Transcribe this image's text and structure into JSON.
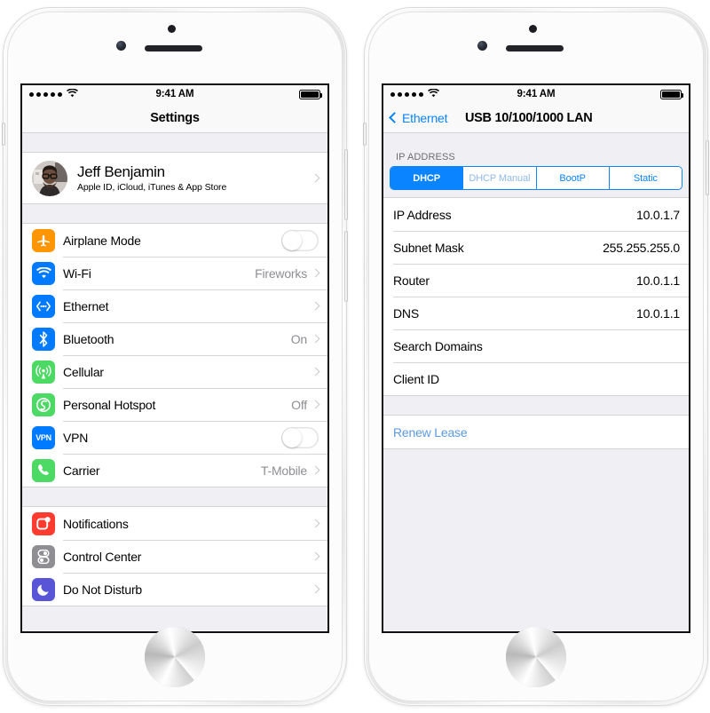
{
  "left_phone": {
    "status_bar": {
      "signal_dots": 5,
      "wifi_icon": "wifi-icon",
      "time": "9:41 AM",
      "battery_icon": "battery-full-icon",
      "battery_level": 100
    },
    "navbar": {
      "title": "Settings"
    },
    "account": {
      "avatar": "user-avatar",
      "name": "Jeff Benjamin",
      "subtitle": "Apple ID, iCloud, iTunes & App Store",
      "chevron": "chevron-right-icon"
    },
    "group_one": [
      {
        "icon": "airplane-icon",
        "icon_color": "#FF9500",
        "label": "Airplane Mode",
        "control": "toggle",
        "toggle_on": false
      },
      {
        "icon": "wifi-icon",
        "icon_color": "#007AFF",
        "label": "Wi-Fi",
        "value": "Fireworks",
        "control": "chevron"
      },
      {
        "icon": "ethernet-icon",
        "icon_color": "#007AFF",
        "label": "Ethernet",
        "value": "",
        "control": "chevron"
      },
      {
        "icon": "bluetooth-icon",
        "icon_color": "#007AFF",
        "label": "Bluetooth",
        "value": "On",
        "control": "chevron"
      },
      {
        "icon": "cellular-icon",
        "icon_color": "#4CD964",
        "label": "Cellular",
        "value": "",
        "control": "chevron"
      },
      {
        "icon": "hotspot-icon",
        "icon_color": "#4CD964",
        "label": "Personal Hotspot",
        "value": "Off",
        "control": "chevron"
      },
      {
        "icon": "vpn-icon",
        "icon_color": "#007AFF",
        "label": "VPN",
        "control": "toggle",
        "toggle_on": false
      },
      {
        "icon": "phone-icon",
        "icon_color": "#4CD964",
        "label": "Carrier",
        "value": "T-Mobile",
        "control": "chevron"
      }
    ],
    "group_two": [
      {
        "icon": "notifications-icon",
        "icon_color": "#FF3B30",
        "label": "Notifications",
        "control": "chevron"
      },
      {
        "icon": "control-center-icon",
        "icon_color": "#8E8E93",
        "label": "Control Center",
        "control": "chevron"
      },
      {
        "icon": "do-not-disturb-icon",
        "icon_color": "#5856D6",
        "label": "Do Not Disturb",
        "control": "chevron"
      }
    ]
  },
  "right_phone": {
    "status_bar": {
      "signal_dots": 5,
      "wifi_icon": "wifi-icon",
      "time": "9:41 AM",
      "battery_icon": "battery-full-icon",
      "battery_level": 100
    },
    "navbar": {
      "back_label": "Ethernet",
      "back_icon": "chevron-left-icon",
      "title": "USB 10/100/1000 LAN"
    },
    "section_header": "IP ADDRESS",
    "segmented": {
      "options": [
        "DHCP",
        "DHCP Manual",
        "BootP",
        "Static"
      ],
      "selected": "DHCP",
      "accent": "#0A84FF"
    },
    "detail_rows": [
      {
        "label": "IP Address",
        "value": "10.0.1.7"
      },
      {
        "label": "Subnet Mask",
        "value": "255.255.255.0"
      },
      {
        "label": "Router",
        "value": "10.0.1.1"
      },
      {
        "label": "DNS",
        "value": "10.0.1.1"
      },
      {
        "label": "Search Domains",
        "value": ""
      },
      {
        "label": "Client ID",
        "value": ""
      }
    ],
    "action": {
      "label": "Renew Lease",
      "color": "#5A9AE0"
    }
  }
}
